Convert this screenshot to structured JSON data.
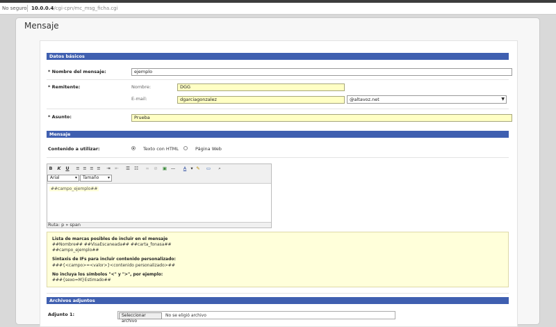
{
  "browser": {
    "insecure_label": "No seguro",
    "url_host": "10.0.0.4",
    "url_path": "/cgi-cpn/mc_msg_ficha.cgi"
  },
  "page": {
    "title": "Mensaje"
  },
  "sections": {
    "basic": "Datos básicos",
    "message": "Mensaje",
    "attachments": "Archivos adjuntos"
  },
  "fields": {
    "name_label": "* Nombre del mensaje:",
    "name_value": "ejemplo",
    "sender_label": "* Remitente:",
    "sender_name_label": "Nombre:",
    "sender_name_value": "DGG",
    "sender_email_label": "E-mail:",
    "sender_email_value": "dgarciagonzalez",
    "sender_domain_value": "@altavoz.net",
    "subject_label": "* Asunto:",
    "subject_value": "Prueba",
    "content_label": "Contenido a utilizar:",
    "option_html": "Texto con HTML",
    "option_web": "Página Web",
    "attachment_label": "Adjunto 1:",
    "file_button": "Seleccionar archivo",
    "file_status": "No se eligió archivo"
  },
  "editor": {
    "bold": "B",
    "italic": "K",
    "underline": "U",
    "font_value": "Arial",
    "size_value": "Tamaño",
    "content": "##campo_ejemplo##",
    "path": "Ruta: p » span"
  },
  "help": {
    "line1": "Lista de marcas posibles de incluir en el mensaje",
    "line2": "##Nombre##   ##VisaEscaneada##   ##carta_fonasa##",
    "line3": "##campo_ejemplo##",
    "line4": "Sintaxis de IFs para incluir contenido personalizado:",
    "line5": "###{<campo>=<valor>}<contenido personalizado>##",
    "line6": "No incluya los símbolos \"<\" y \">\", por ejemplo:",
    "line7": "###{sexo=M}Estimado##"
  },
  "colors": {
    "section_bg": "#3f5fb0",
    "highlight_input": "#ffffc4",
    "note_bg": "#ffffda"
  }
}
